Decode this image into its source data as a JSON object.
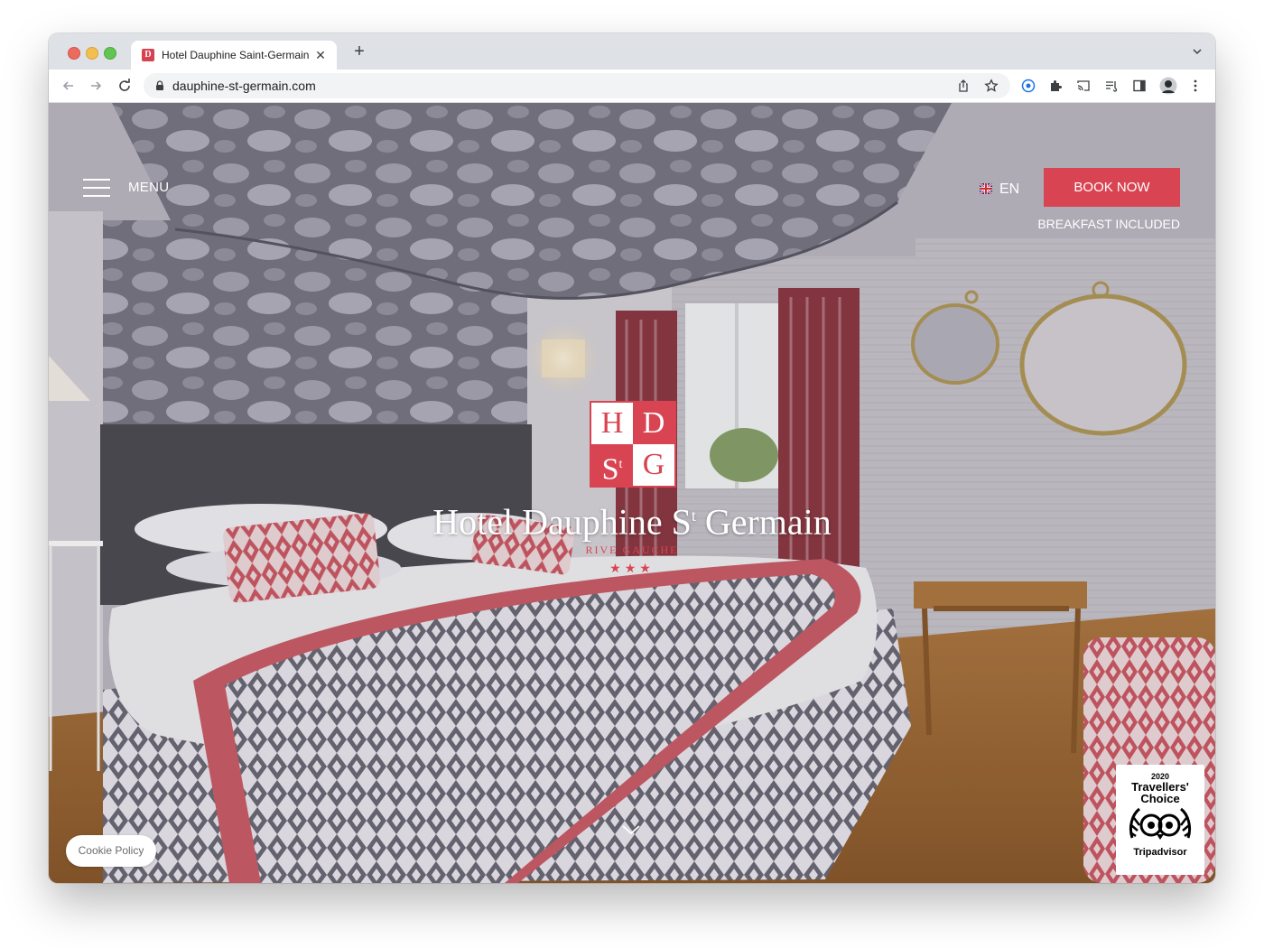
{
  "browser": {
    "tab_title": "Hotel Dauphine Saint-Germain",
    "favicon_letter": "D",
    "url": "dauphine-st-germain.com",
    "new_tab_label": "+",
    "tab_close_label": "✕",
    "colors": {
      "tabstrip": "#dee1e6",
      "toolbar": "#ffffff",
      "omnibox": "#f1f3f4"
    },
    "toolbar_icons": [
      "back-arrow-icon",
      "forward-arrow-icon",
      "reload-icon",
      "lock-icon",
      "share-icon",
      "star-icon",
      "password-manager-icon",
      "extensions-puzzle-icon",
      "cast-icon",
      "reading-list-icon",
      "side-panel-icon",
      "profile-avatar-icon",
      "kebab-menu-icon"
    ]
  },
  "header": {
    "menu_label": "MENU",
    "language": "EN",
    "book_label": "BOOK NOW",
    "tagline": "BREAKFAST INCLUDED"
  },
  "logo": {
    "top_left": "H",
    "top_right": "D",
    "bottom_left": "S",
    "bottom_left_sup": "t",
    "bottom_right": "G"
  },
  "hero": {
    "name_before": "Hotel Dauphine S",
    "name_sup": "t",
    "name_after": " Germain",
    "subtitle": "RIVE GAUCHE",
    "stars": "★★★"
  },
  "cookie": {
    "label": "Cookie Policy"
  },
  "tripadvisor": {
    "year": "2020",
    "title_line1": "Travellers'",
    "title_line2": "Choice",
    "brand": "Tripadvisor"
  },
  "colors": {
    "brand": "#d94452",
    "white": "#ffffff"
  }
}
